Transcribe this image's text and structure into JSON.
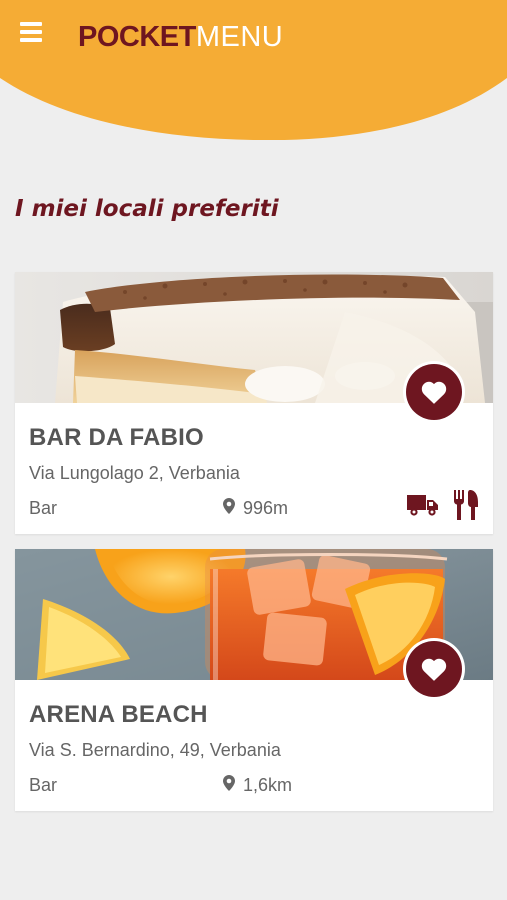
{
  "header": {
    "logo_bold": "POCKET",
    "logo_light": "MENU",
    "menu_icon": "hamburger-icon",
    "colors": {
      "header": "#f5ac35",
      "brand": "#6e1620",
      "background": "#eeeeee"
    }
  },
  "section": {
    "title": "I miei locali preferiti"
  },
  "cards": [
    {
      "name": "BAR DA FABIO",
      "address": "Via Lungolago 2, Verbania",
      "type": "Bar",
      "distance": "996m",
      "image": "tiramisu-photo",
      "favorite": true,
      "services": [
        "delivery-truck-icon",
        "fork-knife-icon"
      ]
    },
    {
      "name": "ARENA BEACH",
      "address": "Via S. Bernardino, 49, Verbania",
      "type": "Bar",
      "distance": "1,6km",
      "image": "spritz-cocktail-photo",
      "favorite": true,
      "services": []
    }
  ]
}
